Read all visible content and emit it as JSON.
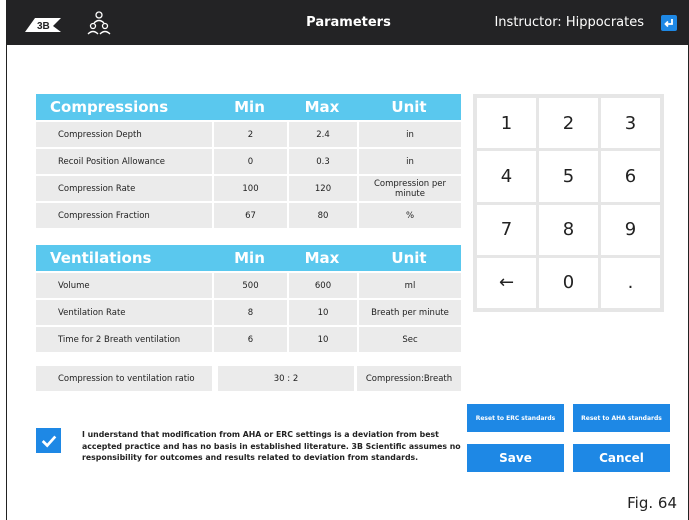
{
  "header": {
    "title": "Parameters",
    "instructor": "Instructor: Hippocrates"
  },
  "compressions": {
    "headers": [
      "Compressions",
      "Min",
      "Max",
      "Unit"
    ],
    "rows": [
      [
        "Compression Depth",
        "2",
        "2.4",
        "in"
      ],
      [
        "Recoil Position Allowance",
        "0",
        "0.3",
        "in"
      ],
      [
        "Compression Rate",
        "100",
        "120",
        "Compression per minute"
      ],
      [
        "Compression Fraction",
        "67",
        "80",
        "%"
      ]
    ]
  },
  "ventilations": {
    "headers": [
      "Ventilations",
      "Min",
      "Max",
      "Unit"
    ],
    "rows": [
      [
        "Volume",
        "500",
        "600",
        "ml"
      ],
      [
        "Ventilation Rate",
        "8",
        "10",
        "Breath per minute"
      ],
      [
        "Time for 2 Breath ventilation",
        "6",
        "10",
        "Sec"
      ]
    ]
  },
  "ratio": {
    "label": "Compression to ventilation ratio",
    "value": "30 : 2",
    "unit": "Compression:Breath"
  },
  "keypad": [
    "1",
    "2",
    "3",
    "4",
    "5",
    "6",
    "7",
    "8",
    "9",
    "←",
    "0",
    "."
  ],
  "buttons": {
    "reset_erc": "Reset to ERC standards",
    "reset_aha": "Reset to AHA standards",
    "save": "Save",
    "cancel": "Cancel"
  },
  "disclaimer": "I understand that modification from AHA or ERC settings is a deviation from best accepted practice and has no basis in established literature. 3B Scientific assumes no responsibility for outcomes and results related to deviation from standards.",
  "figure_label": "Fig. 64",
  "colors": {
    "accent": "#1e88e5",
    "table_header": "#5ac8ee",
    "header_bg": "#232325"
  }
}
